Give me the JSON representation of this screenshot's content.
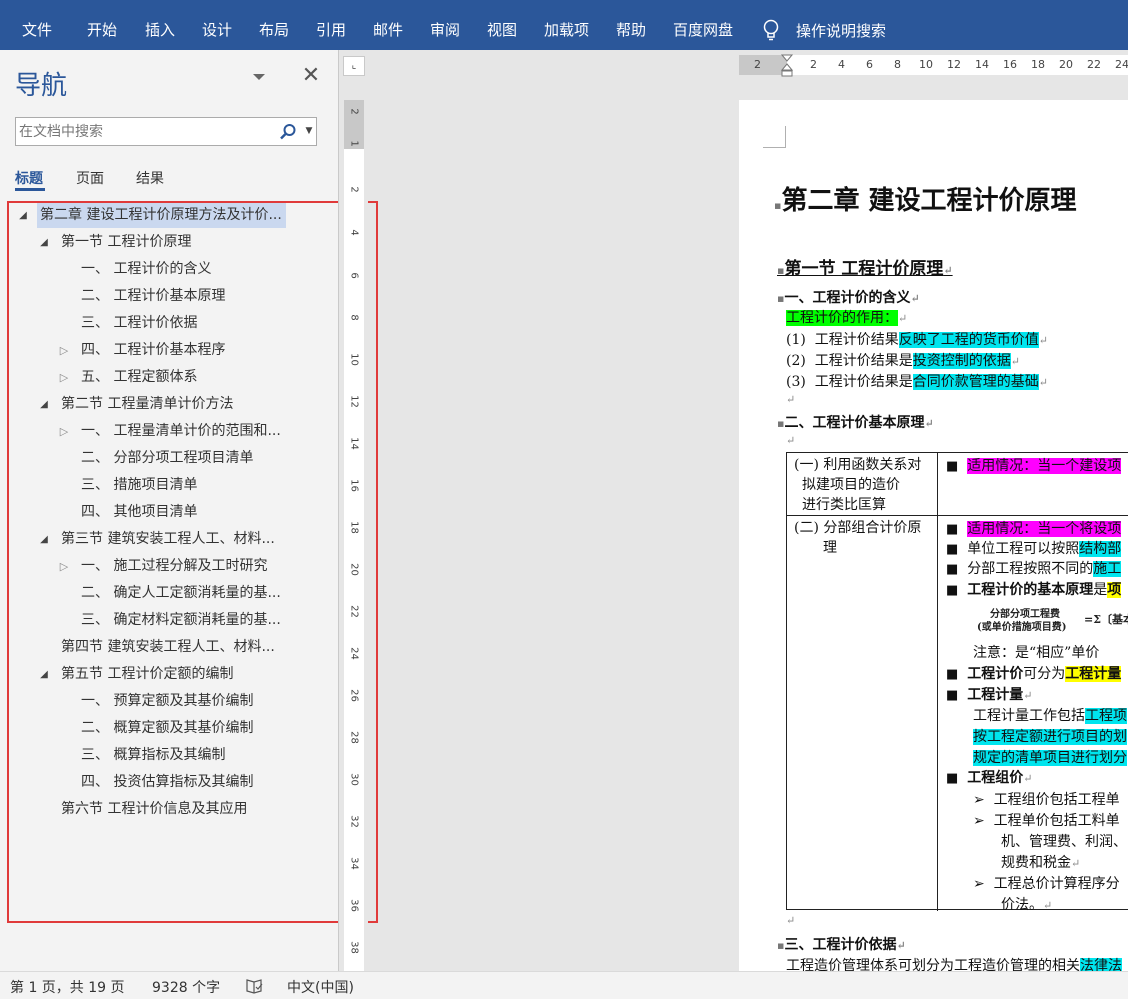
{
  "ribbon": {
    "tabs": [
      "文件",
      "开始",
      "插入",
      "设计",
      "布局",
      "引用",
      "邮件",
      "审阅",
      "视图",
      "加载项",
      "帮助",
      "百度网盘"
    ],
    "tell_me": "操作说明搜索"
  },
  "nav": {
    "title": "导航",
    "search_placeholder": "在文档中搜索",
    "tabs": [
      "标题",
      "页面",
      "结果"
    ],
    "active_tab": "标题",
    "headings": [
      {
        "label": "第二章 建设工程计价原理方法及计价...",
        "level": 1,
        "state": "expanded",
        "selected": true
      },
      {
        "label": "第一节 工程计价原理",
        "level": 2,
        "state": "expanded"
      },
      {
        "label": "一、 工程计价的含义",
        "level": 3,
        "state": "none"
      },
      {
        "label": "二、 工程计价基本原理",
        "level": 3,
        "state": "none"
      },
      {
        "label": "三、 工程计价依据",
        "level": 3,
        "state": "none"
      },
      {
        "label": "四、 工程计价基本程序",
        "level": 3,
        "state": "collapsed"
      },
      {
        "label": "五、 工程定额体系",
        "level": 3,
        "state": "collapsed"
      },
      {
        "label": "第二节 工程量清单计价方法",
        "level": 2,
        "state": "expanded"
      },
      {
        "label": "一、 工程量清单计价的范围和...",
        "level": 3,
        "state": "collapsed"
      },
      {
        "label": "二、 分部分项工程项目清单",
        "level": 3,
        "state": "none"
      },
      {
        "label": "三、 措施项目清单",
        "level": 3,
        "state": "none"
      },
      {
        "label": "四、 其他项目清单",
        "level": 3,
        "state": "none"
      },
      {
        "label": "第三节 建筑安装工程人工、材料...",
        "level": 2,
        "state": "expanded"
      },
      {
        "label": "一、 施工过程分解及工时研究",
        "level": 3,
        "state": "collapsed"
      },
      {
        "label": "二、 确定人工定额消耗量的基...",
        "level": 3,
        "state": "none"
      },
      {
        "label": "三、 确定材料定额消耗量的基...",
        "level": 3,
        "state": "none"
      },
      {
        "label": "第四节 建筑安装工程人工、材料...",
        "level": 2,
        "state": "none"
      },
      {
        "label": "第五节 工程计价定额的编制",
        "level": 2,
        "state": "expanded"
      },
      {
        "label": "一、 预算定额及其基价编制",
        "level": 3,
        "state": "none"
      },
      {
        "label": "二、 概算定额及其基价编制",
        "level": 3,
        "state": "none"
      },
      {
        "label": "三、 概算指标及其编制",
        "level": 3,
        "state": "none"
      },
      {
        "label": "四、 投资估算指标及其编制",
        "level": 3,
        "state": "none"
      },
      {
        "label": "第六节 工程计价信息及其应用",
        "level": 2,
        "state": "none"
      }
    ]
  },
  "vruler": {
    "labels": [
      "2",
      "1",
      "2",
      "4",
      "6",
      "8",
      "10",
      "12",
      "14",
      "16",
      "18",
      "20",
      "22",
      "24",
      "26",
      "28",
      "30",
      "32",
      "34",
      "36",
      "38"
    ]
  },
  "hruler": {
    "labels": [
      "2",
      "2",
      "4",
      "6",
      "8",
      "10",
      "12",
      "14",
      "16",
      "18",
      "20",
      "22",
      "24"
    ]
  },
  "doc": {
    "chapter_title": "第二章  建设工程计价原理",
    "section1": "第一节  工程计价原理",
    "h_1": "一、工程计价的含义",
    "role_label": "工程计价的作用：",
    "items": [
      {
        "num": "(1)",
        "pre": "工程计价结果",
        "hl": "反映了工程的货币价值"
      },
      {
        "num": "(2)",
        "pre": "工程计价结果是",
        "hl": "投资控制的依据"
      },
      {
        "num": "(3)",
        "pre": "工程计价结果是",
        "hl": "合同价款管理的基础"
      }
    ],
    "h_2": "二、工程计价基本原理",
    "table": {
      "row1_left": [
        "(一) 利用函数关系对",
        "拟建项目的造价",
        "进行类比匡算"
      ],
      "row1_right": "适用情况：当一个建设项",
      "row2_left": [
        "(二) 分部组合计价原",
        "理"
      ],
      "r2_1": "适用情况：当一个将设项",
      "r2_2_pre": "单位工程可以按照",
      "r2_2_hl": "结构部",
      "r2_3_pre": "分部工程按照不同的",
      "r2_3_hl": "施工",
      "r2_4_pre": "工程计价的基本原理",
      "r2_4_mid": "是",
      "r2_4_hl": "项",
      "formula_1": "分部分项工程费",
      "formula_2": "(或单价措施项目费)",
      "formula_3": "=Σ〔基本材",
      "note": "注意：是“相应”单价",
      "r2_5_pre": "工程计价",
      "r2_5_mid": "可分为",
      "r2_5_hl": "工程计量",
      "r2_6": "工程计量",
      "r2_7_pre": "工程计量工作包括",
      "r2_7_hl": "工程项",
      "r2_8": "按工程定额进行项目的划",
      "r2_9": "规定的清单项目进行划分",
      "r2_10": "工程组价",
      "sub_1": "工程组价包括工程单",
      "sub_2": "工程单价包括工料单",
      "sub_2b": "机、管理费、利润、",
      "sub_2c": "规费和税金",
      "sub_3": "工程总价计算程序分",
      "sub_3b": "价法。"
    },
    "h_3": "三、工程计价依据",
    "last_pre": "工程造价管理体系可划分为工程造价管理的相关",
    "last_hl": "法律法"
  },
  "status": {
    "page": "第 1 页，共 19 页",
    "words": "9328 个字",
    "lang": "中文(中国)"
  },
  "colors": {
    "ribbon": "#2b579a",
    "accent": "#2b579a",
    "highlight_green": "#00ff00",
    "highlight_cyan": "#00e5ee",
    "highlight_magenta": "#ff00ff",
    "highlight_yellow": "#ffff00",
    "annotation_box": "#e03a3a"
  }
}
